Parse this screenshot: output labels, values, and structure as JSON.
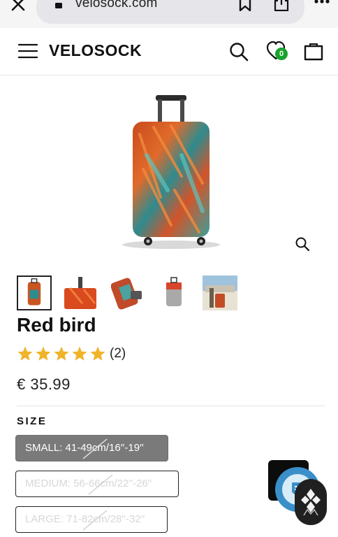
{
  "browser": {
    "url": "velosock.com",
    "icons": [
      "close-icon",
      "lock-icon",
      "bookmark-icon",
      "share-icon",
      "more-icon"
    ]
  },
  "header": {
    "brand": "VELOSOCK",
    "wishlist_count": "0",
    "icons": [
      "menu-icon",
      "search-icon",
      "heart-icon",
      "shopping-bag-icon"
    ]
  },
  "product": {
    "title": "Red bird",
    "rating": 5,
    "review_count": "(2)",
    "price": "€ 35.99",
    "thumbnails": [
      "Suitcase front view",
      "Suitcase side view",
      "Suitcase with camera",
      "Suitcase rear view",
      "Suitcase on ship"
    ],
    "selected_thumbnail": 0
  },
  "size": {
    "label": "SIZE",
    "options": [
      {
        "label": "SMALL: 41-49cm/16′′-19′′",
        "state": "selected"
      },
      {
        "label": "MEDIUM: 56-66cm/22′′-26′′",
        "state": "unavailable"
      },
      {
        "label": "LARGE: 71-82cm/28′′-32′′",
        "state": "unavailable"
      }
    ]
  },
  "colors": {
    "accent": "#19a32e",
    "selected_size": "#7a7a7a",
    "help_widget": "#3a8fc9",
    "star": "#f0b429"
  }
}
